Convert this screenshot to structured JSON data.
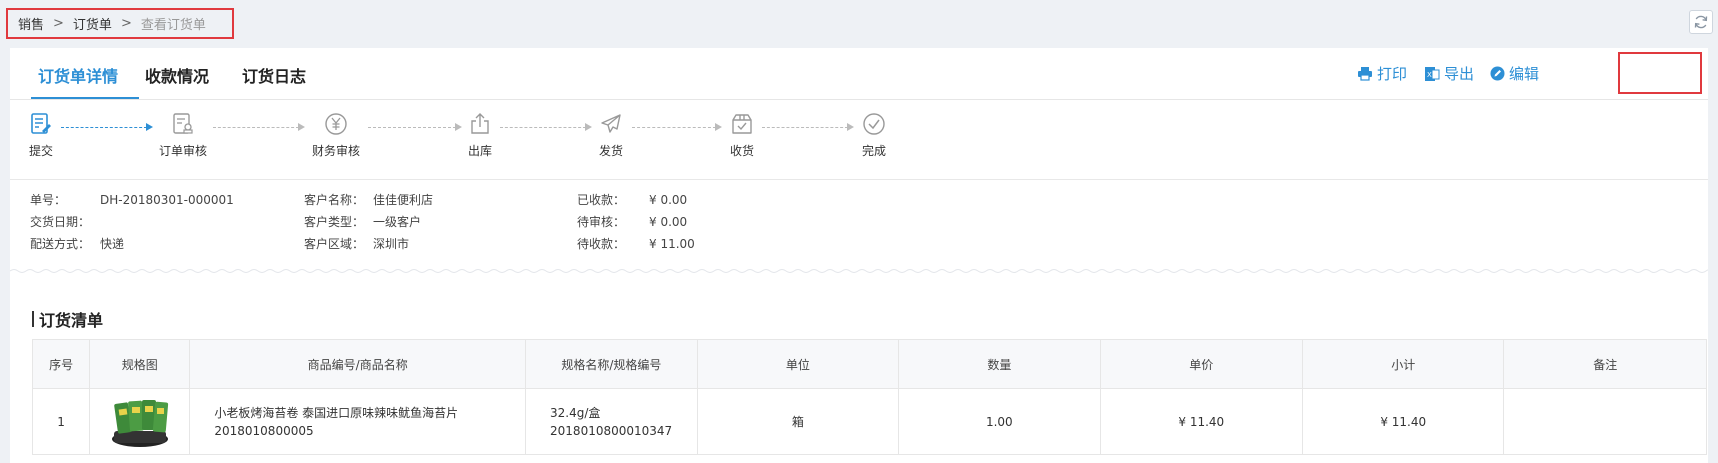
{
  "breadcrumb": {
    "items": [
      "销售",
      "订货单",
      "查看订货单"
    ]
  },
  "tabs": [
    {
      "label": "订货单详情"
    },
    {
      "label": "收款情况"
    },
    {
      "label": "订货日志"
    }
  ],
  "actions": {
    "print": "打印",
    "export": "导出",
    "edit": "编辑"
  },
  "steps": [
    {
      "label": "提交",
      "icon": "submit-icon",
      "done": true
    },
    {
      "label": "订单审核",
      "icon": "order-review-icon",
      "done": false
    },
    {
      "label": "财务审核",
      "icon": "finance-review-icon",
      "done": false
    },
    {
      "label": "出库",
      "icon": "outbound-icon",
      "done": false
    },
    {
      "label": "发货",
      "icon": "ship-icon",
      "done": false
    },
    {
      "label": "收货",
      "icon": "receive-icon",
      "done": false
    },
    {
      "label": "完成",
      "icon": "complete-icon",
      "done": false
    }
  ],
  "order_info": {
    "order_no_label": "单号：",
    "order_no": "DH-20180301-000001",
    "delivery_date_label": "交货日期：",
    "delivery_date": "",
    "shipping_label": "配送方式：",
    "shipping": "快递",
    "customer_name_label": "客户名称：",
    "customer_name": "佳佳便利店",
    "customer_type_label": "客户类型：",
    "customer_type": "一级客户",
    "customer_region_label": "客户区域：",
    "customer_region": "深圳市",
    "received_label": "已收款：",
    "received": "¥ 0.00",
    "pending_review_label": "待审核：",
    "pending_review": "¥ 0.00",
    "to_collect_label": "待收款：",
    "to_collect": "¥ 11.00"
  },
  "order_list": {
    "title": "订货清单",
    "columns": [
      "序号",
      "规格图",
      "商品编号/商品名称",
      "规格名称/规格编号",
      "单位",
      "数量",
      "单价",
      "小计",
      "备注"
    ],
    "rows": [
      {
        "index": "1",
        "product_name": "小老板烤海苔卷 泰国进口原味辣味鱿鱼海苔片",
        "product_code": "2018010800005",
        "spec_name": "32.4g/盒",
        "spec_code": "2018010800010347",
        "unit": "箱",
        "quantity": "1.00",
        "price": "¥ 11.40",
        "subtotal": "¥ 11.40",
        "remark": ""
      }
    ]
  },
  "colors": {
    "accent": "#2d8fd5",
    "highlight_border": "#e0393e"
  }
}
